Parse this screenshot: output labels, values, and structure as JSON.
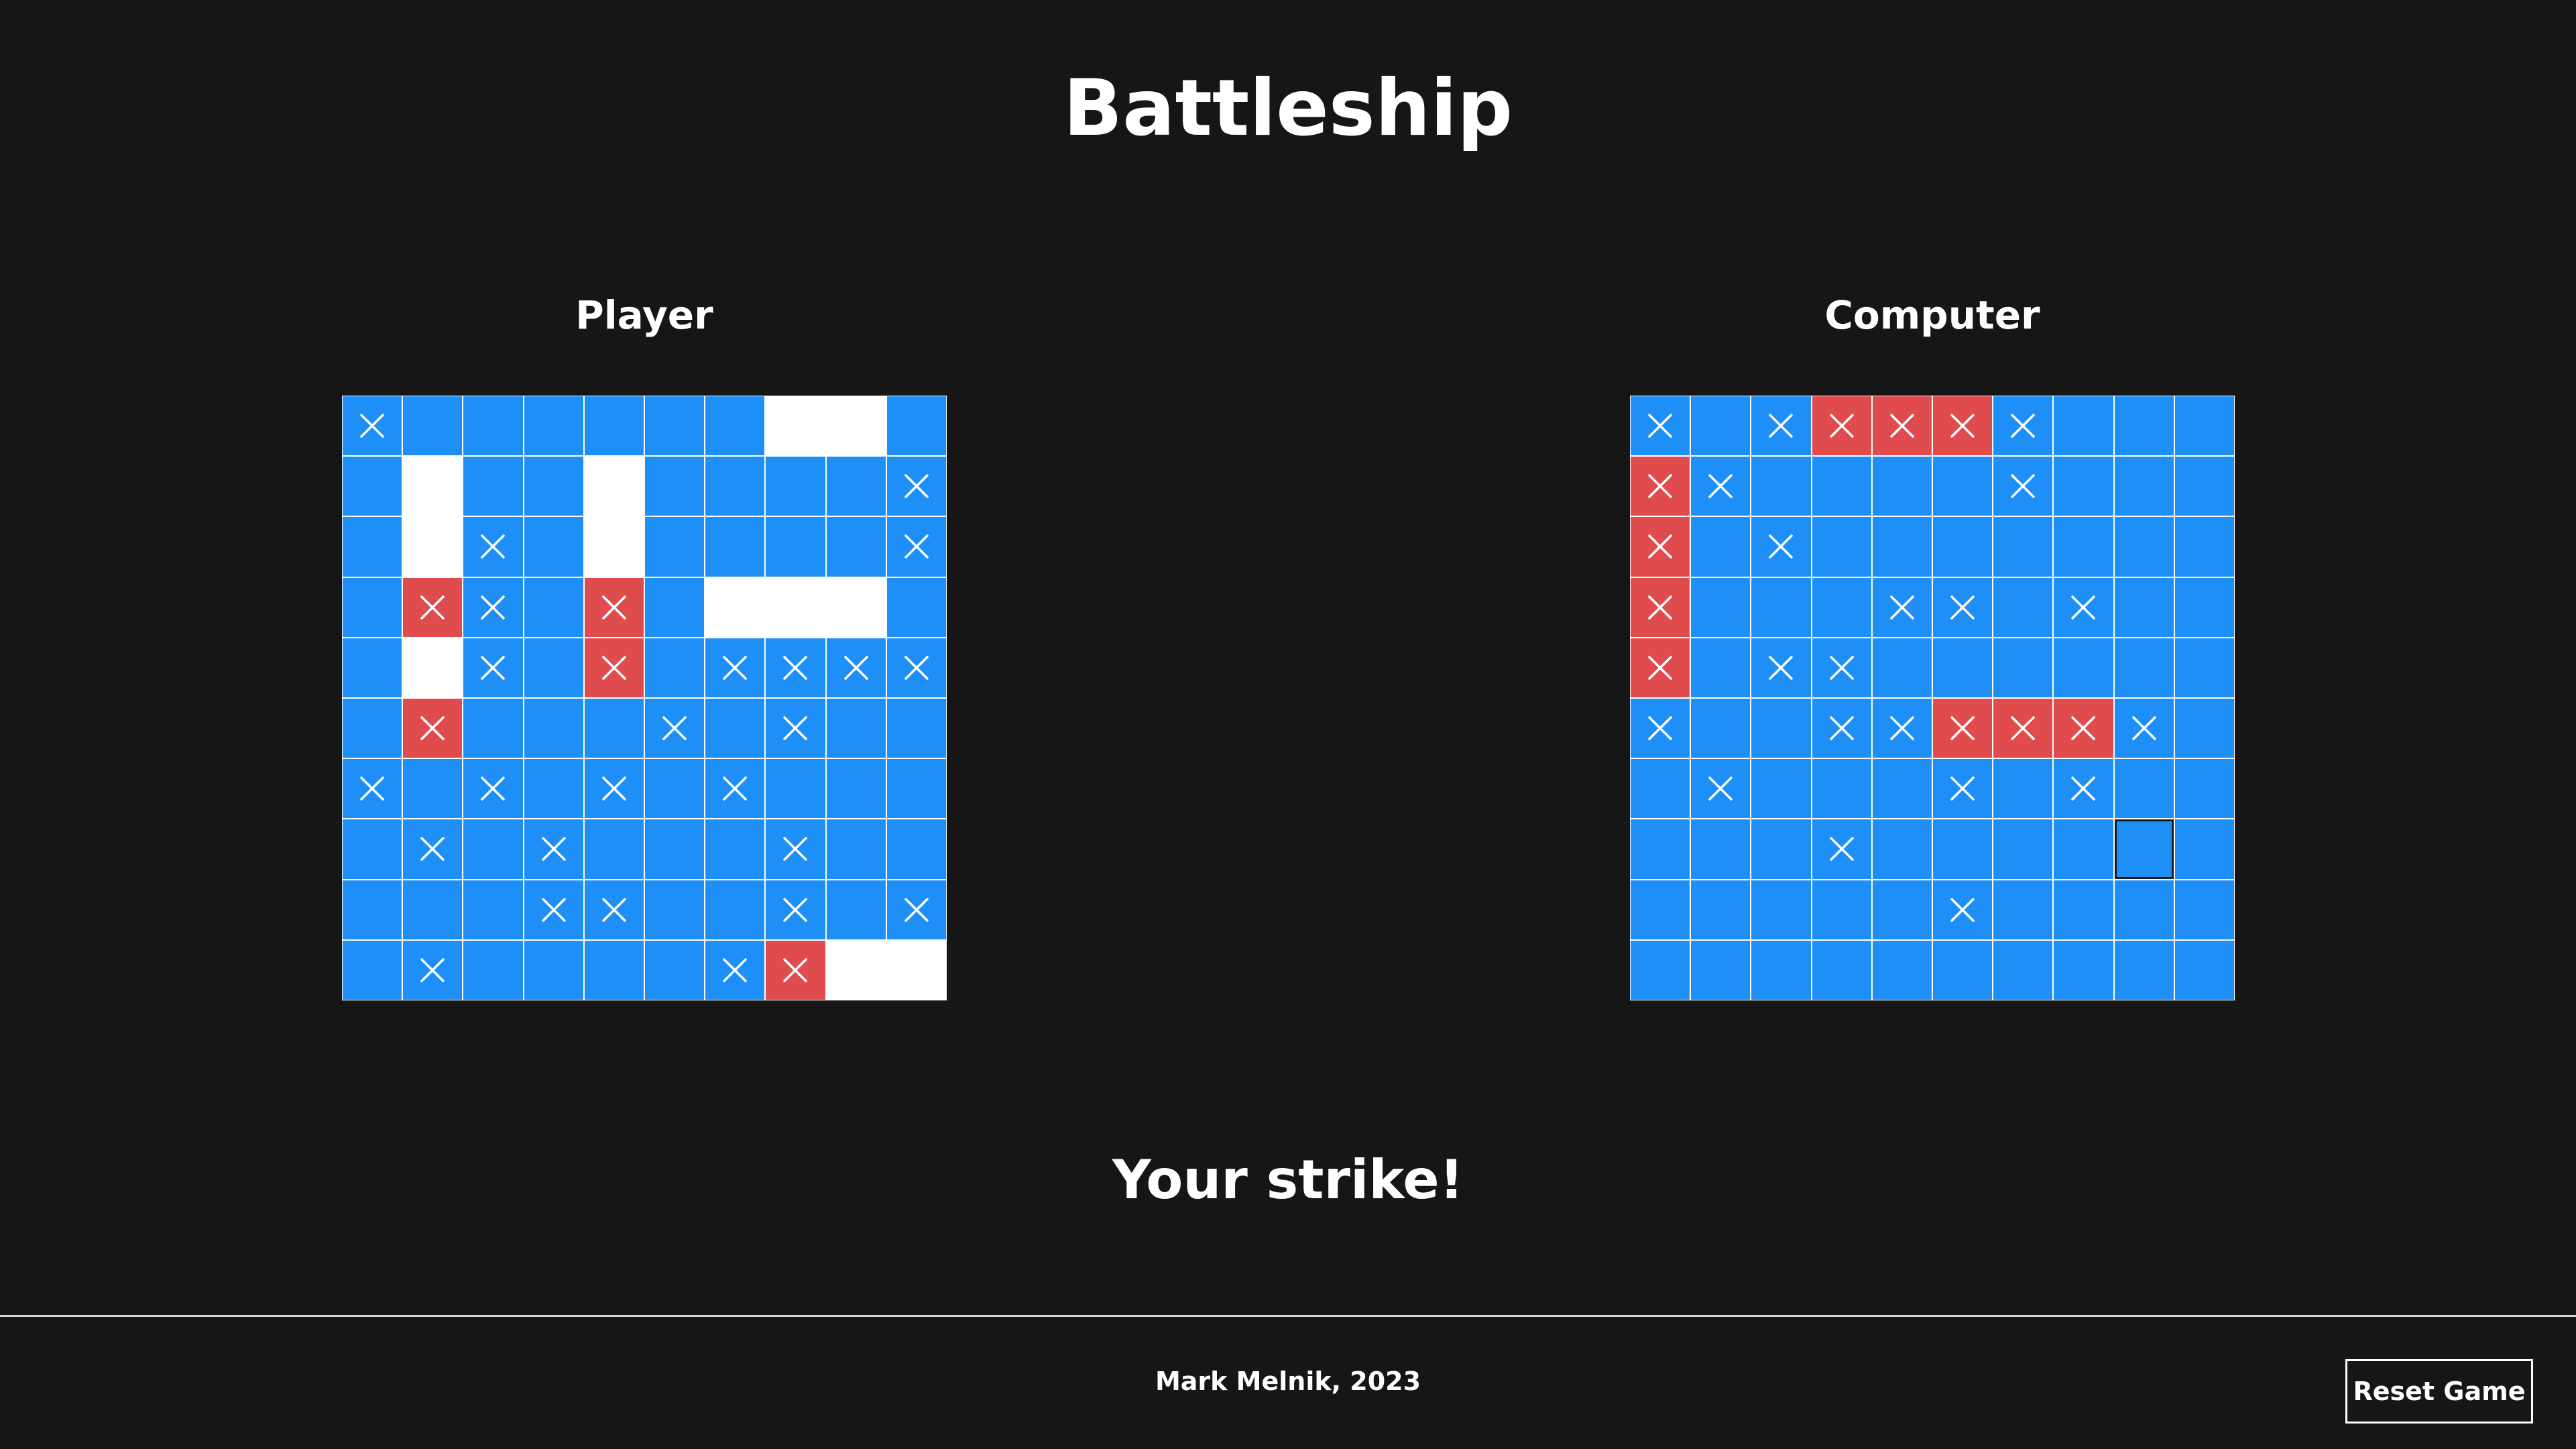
{
  "app": {
    "title": "Battleship",
    "status": "Your strike!",
    "footer": "Mark Melnik, 2023",
    "reset_label": "Reset Game"
  },
  "colors": {
    "background": "#161616",
    "water": "#1e8ff7",
    "ship": "#ffffff",
    "hit": "#e04b4e",
    "mark": "#ffffff"
  },
  "legend": {
    "s": "ship",
    "x": "miss",
    "h": "hit",
    "o": "hover",
    "_": "water"
  },
  "player": {
    "label": "Player",
    "grid": [
      "x______ss_",
      "_s__s____x",
      "_sx_s____x",
      "_hx_h_sss_",
      "_sx_h_xxxx",
      "_h___x_x__",
      "x_x_x_x___",
      "_x_x___x__",
      "___xx__x_x",
      "_x____xhss"
    ]
  },
  "computer": {
    "label": "Computer",
    "grid": [
      "x_xhhhx___",
      "hx____x___",
      "h_x_______",
      "h___xx_x__",
      "h_xx______",
      "x__xxhhhx_",
      "_x___x_x__",
      "___x____o_",
      "_____x____",
      "__________"
    ]
  }
}
